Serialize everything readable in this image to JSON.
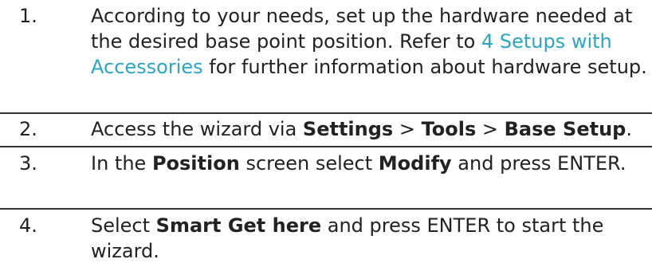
{
  "steps": [
    {
      "number": "1.",
      "text_before": "According to your needs, set up the hardware needed at the desired base point position. Refer to ",
      "link": "4 Setups with Accessories",
      "text_after": " for further information about hardware setup."
    },
    {
      "number": "2.",
      "p1": "Access the wizard via ",
      "b1": "Settings",
      "sep1": " > ",
      "b2": "Tools",
      "sep2": " > ",
      "b3": "Base Setup",
      "end": "."
    },
    {
      "number": "3.",
      "p1": "In the ",
      "b1": "Position",
      "p2": " screen select ",
      "b2": "Modify",
      "p3": " and press ENTER."
    },
    {
      "number": "4.",
      "p1": "Select ",
      "b1": "Smart Get here",
      "p2": " and press ENTER to start the wizard."
    }
  ]
}
